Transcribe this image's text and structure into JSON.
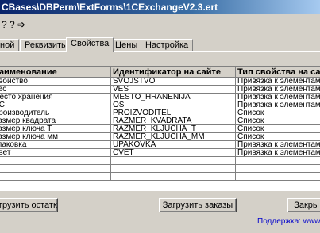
{
  "window": {
    "title": "CBases\\DBPerm\\ExtForms\\1CExchangeV2.3.ert"
  },
  "toolbar": {
    "items": [
      "?",
      "?",
      "➩"
    ]
  },
  "tabs": [
    {
      "label": "ной",
      "active": false
    },
    {
      "label": "Реквизиты",
      "active": false
    },
    {
      "label": "Свойства",
      "active": true
    },
    {
      "label": "Цены",
      "active": false
    },
    {
      "label": "Настройка",
      "active": false
    }
  ],
  "grid": {
    "columns": [
      "Наименование",
      "Идентификатор на сайте",
      "Тип свойства на са..."
    ],
    "rows": [
      [
        "Свойство",
        "SVOJSTVO",
        "Привязка к элементам"
      ],
      [
        "Вес",
        "VES",
        "Привязка к элементам"
      ],
      [
        "Место хранения",
        "MESTO_HRANENIJA",
        "Привязка к элементам"
      ],
      [
        "ОС",
        "OS",
        "Привязка к элементам"
      ],
      [
        "Производитель",
        "PROIZVODITEL",
        "Список"
      ],
      [
        "Размер квадрата",
        "RAZMER_KVADRATA",
        "Список"
      ],
      [
        "Размер ключа Т",
        "RAZMER_KLJUCHA_T",
        "Список"
      ],
      [
        "Размер ключа мм",
        "RAZMER_KLJUCHA_MM",
        "Список"
      ],
      [
        "Упаковка",
        "UPAKOVKA",
        "Привязка к элементам"
      ],
      [
        "Цвет",
        "CVET",
        "Привязка к элементам"
      ],
      [
        "",
        "",
        ""
      ],
      [
        "",
        "",
        ""
      ],
      [
        "",
        "",
        ""
      ]
    ]
  },
  "buttons": {
    "load_stock": "грузить остатки",
    "load_orders": "Загрузить заказы",
    "close": "Закры"
  },
  "footer": {
    "support": "Поддержка: www.b"
  }
}
